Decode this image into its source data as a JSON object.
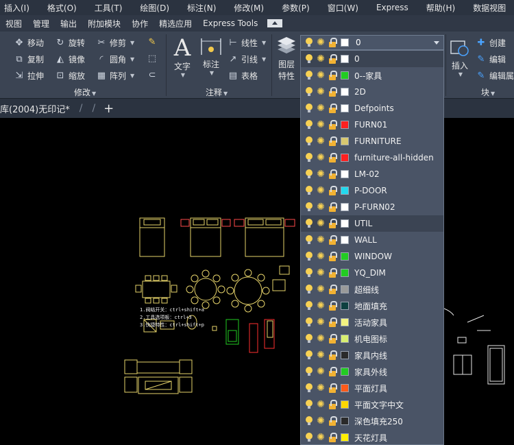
{
  "menu": [
    "插入(I)",
    "格式(O)",
    "工具(T)",
    "绘图(D)",
    "标注(N)",
    "修改(M)",
    "参数(P)",
    "窗口(W)",
    "Express",
    "帮助(H)",
    "数据视图"
  ],
  "tabs": [
    "视图",
    "管理",
    "输出",
    "附加模块",
    "协作",
    "精选应用",
    "Express Tools"
  ],
  "ribbon": {
    "modify": {
      "move": "移动",
      "rotate": "旋转",
      "trim": "修剪",
      "copy": "复制",
      "mirror": "镜像",
      "fillet": "圆角",
      "stretch": "拉伸",
      "scale": "缩放",
      "array": "阵列",
      "title": "修改"
    },
    "annotation": {
      "text": "文字",
      "dimension": "标注",
      "linear": "线性",
      "leader": "引线",
      "table": "表格",
      "title": "注释"
    },
    "layers": {
      "layer_props_1": "图层",
      "layer_props_2": "特性"
    },
    "block": {
      "insert": "插入",
      "create": "创建",
      "edit": "编辑",
      "edit_attr": "编辑属",
      "title": "块"
    }
  },
  "doc_tab": {
    "name": "库(2004)无印记*"
  },
  "layer_dropdown": {
    "current": "0"
  },
  "layers": [
    {
      "name": "0",
      "color": "#ffffff"
    },
    {
      "name": "0--家具",
      "color": "#22cc22"
    },
    {
      "name": "2D",
      "color": "#ffffff"
    },
    {
      "name": "Defpoints",
      "color": "#ffffff"
    },
    {
      "name": "FURN01",
      "color": "#ff2020"
    },
    {
      "name": "FURNITURE",
      "color": "#d8c870"
    },
    {
      "name": "furniture-all-hidden",
      "color": "#ff2020"
    },
    {
      "name": "LM-02",
      "color": "#ffffff"
    },
    {
      "name": "P-DOOR",
      "color": "#22d8ee"
    },
    {
      "name": "P-FURN02",
      "color": "#ffffff"
    },
    {
      "name": "UTIL",
      "color": "#ffffff"
    },
    {
      "name": "WALL",
      "color": "#ffffff"
    },
    {
      "name": "WINDOW",
      "color": "#22cc22"
    },
    {
      "name": "YQ_DIM",
      "color": "#22cc22"
    },
    {
      "name": "超细线",
      "color": "#9a9a9a"
    },
    {
      "name": "地面填充",
      "color": "#0d4040"
    },
    {
      "name": "活动家具",
      "color": "#f2f280"
    },
    {
      "name": "机电图标",
      "color": "#d8ee70"
    },
    {
      "name": "家具内线",
      "color": "#2a2a2a"
    },
    {
      "name": "家具外线",
      "color": "#22cc22"
    },
    {
      "name": "平面灯具",
      "color": "#ff5a1a"
    },
    {
      "name": "平面文字中文",
      "color": "#ffd700"
    },
    {
      "name": "深色填充250",
      "color": "#2a2a2a"
    },
    {
      "name": "天花灯具",
      "color": "#ffee00"
    }
  ],
  "selected_index": 10,
  "canvas_notes": [
    "1.阀结开关：ctrl+shift+a",
    "2.工具选项板：ctrl+3",
    "3.快捷特性：ctrl+shift+p"
  ]
}
